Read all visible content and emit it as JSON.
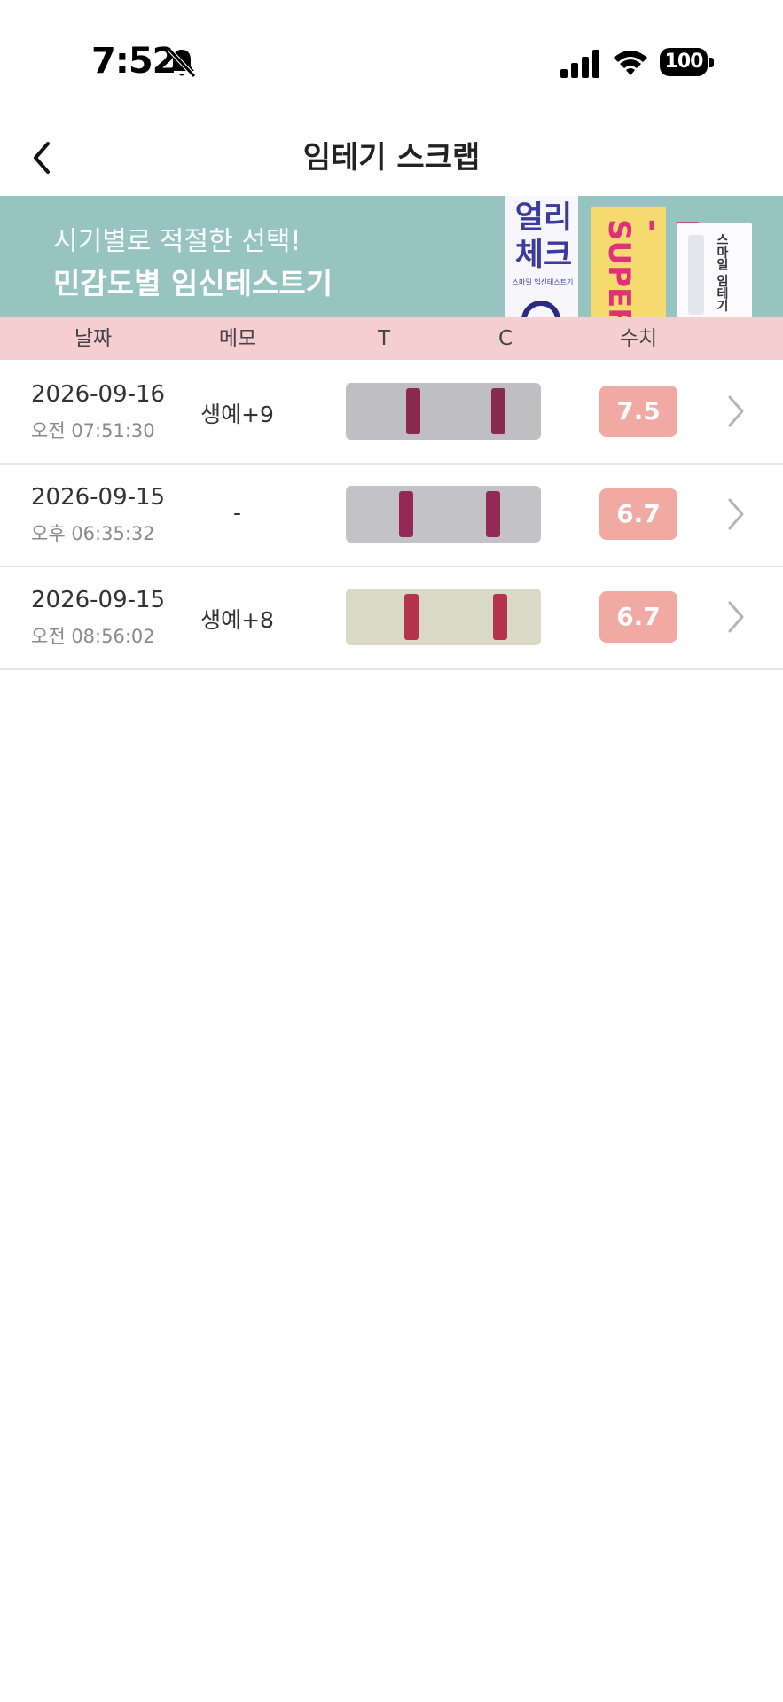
{
  "status_bar": {
    "time": "7:52",
    "battery": "100"
  },
  "nav": {
    "title": "임테기 스크랩"
  },
  "banner": {
    "line1": "시기별로 적절한 선택!",
    "line2": "민감도별 임신테스트기",
    "product1_name": "얼리\n체크",
    "product1_sub": "스마일 임신테스트기",
    "product2_name": "DAVID\n-SUPER",
    "product3_name": "스마일 임테기"
  },
  "table": {
    "headers": {
      "date": "날짜",
      "memo": "메모",
      "t": "T",
      "c": "C",
      "value": "수치"
    },
    "rows": [
      {
        "date": "2026-09-16",
        "time": "오전 07:51:30",
        "memo": "생예+9",
        "value": "7.5",
        "strip_color": "#bfbfc1",
        "line_color": "#8a2a4e"
      },
      {
        "date": "2026-09-15",
        "time": "오후 06:35:32",
        "memo": "-",
        "value": "6.7",
        "strip_color": "#c3c3c5",
        "line_color": "#922a55"
      },
      {
        "date": "2026-09-15",
        "time": "오전 08:56:02",
        "memo": "생예+8",
        "value": "6.7",
        "strip_color": "#d9d9c6",
        "line_color": "#b5334f"
      }
    ]
  },
  "colors": {
    "banner_bg": "#97c4c0",
    "header_bg": "#f5cfcf",
    "badge_bg": "#f0a9a3"
  }
}
